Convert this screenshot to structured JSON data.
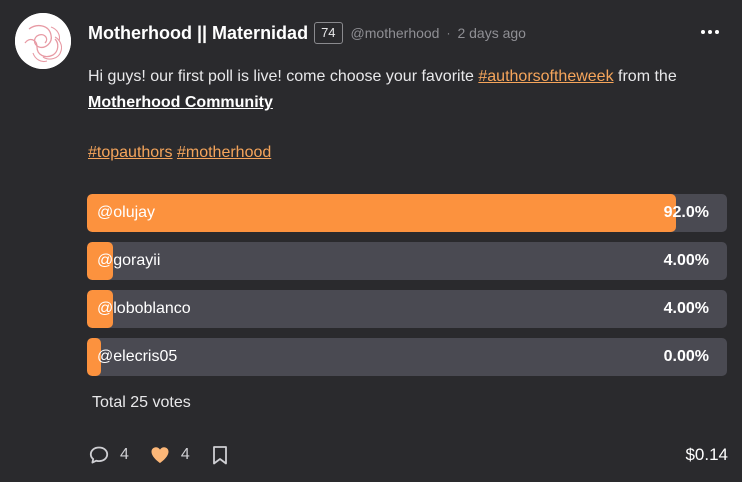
{
  "post": {
    "author_name": "Motherhood || Maternidad",
    "reputation": "74",
    "handle": "@motherhood",
    "separator": "·",
    "time_ago": "2 days ago"
  },
  "body": {
    "text_before": "Hi guys! our first poll is live! come choose your favorite ",
    "hashtag_authorsoftheweek": "#authorsoftheweek",
    "text_mid": " from the ",
    "community_link": "Motherhood Community",
    "tag_topauthors": "#topauthors",
    "tag_motherhood": "#motherhood"
  },
  "poll": {
    "options": [
      {
        "label": "@olujay",
        "percent_text": "92.0%",
        "percent": 92.0
      },
      {
        "label": "@gorayii",
        "percent_text": "4.00%",
        "percent": 4.0
      },
      {
        "label": "@loboblanco",
        "percent_text": "4.00%",
        "percent": 4.0
      },
      {
        "label": "@elecris05",
        "percent_text": "0.00%",
        "percent": 0.0
      }
    ],
    "total_votes": "Total 25 votes"
  },
  "footer": {
    "comments_count": "4",
    "likes_count": "4",
    "payout": "$0.14"
  },
  "colors": {
    "accent": "#fc923e",
    "hashtag": "#f6a55b",
    "background": "#2a2a2d",
    "poll_track": "#4a4a52"
  },
  "icons": {
    "comment": "speech-bubble-icon",
    "like": "heart-icon",
    "bookmark": "bookmark-icon",
    "more": "more-dots-icon"
  }
}
